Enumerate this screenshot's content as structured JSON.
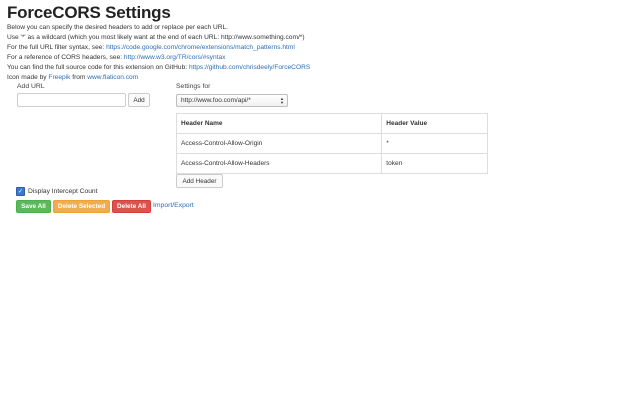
{
  "page": {
    "title": "ForceCORS Settings"
  },
  "intro": {
    "line1": "Below you can specify the desired headers to add or replace per each URL.",
    "line2": "Use '*' as a wildcard (which you most likely want at the end of each URL: http://www.something.com/*)",
    "line3_text": "For the full URL filter syntax, see: ",
    "line3_link": "https://code.google.com/chrome/extensions/match_patterns.html",
    "line4_text": "For a reference of CORS headers, see: ",
    "line4_link": "http://www.w3.org/TR/cors/#syntax",
    "line5_text": "You can find the full source code for this extension on GitHub: ",
    "line5_link": "https://github.com/chrisdeely/ForceCORS",
    "line6_text1": "Icon made by ",
    "line6_link1": "Freepik",
    "line6_text2": " from ",
    "line6_link2": "www.flaticon.com"
  },
  "add_url": {
    "label": "Add URL",
    "input_value": "",
    "button_label": "Add"
  },
  "settings": {
    "label": "Settings for",
    "selected_url": "http://www.foo.com/api/*"
  },
  "table": {
    "columns": [
      "Header Name",
      "Header Value"
    ],
    "rows": [
      {
        "name": "Access-Control-Allow-Origin",
        "value": "*"
      },
      {
        "name": "Access-Control-Allow-Headers",
        "value": "token"
      }
    ],
    "add_button_label": "Add Header"
  },
  "options": {
    "display_intercept_label": "Display Intercept Count",
    "display_intercept_checked": true
  },
  "actions": {
    "save_all": "Save All",
    "delete_selected": "Delete Selected",
    "delete_all": "Delete All",
    "import_export": "Import/Export"
  },
  "colors": {
    "save": "#5cb85c",
    "delete_selected": "#f0ad4e",
    "delete_all": "#d9534f",
    "link": "#2a6db8"
  }
}
